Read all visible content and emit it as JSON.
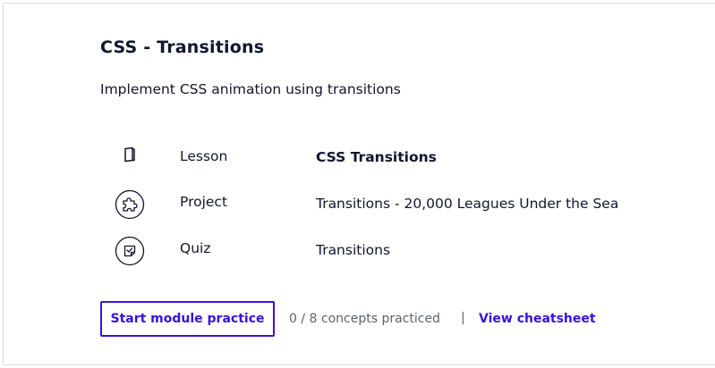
{
  "module": {
    "title": "CSS - Transitions",
    "description": "Implement CSS animation using transitions"
  },
  "items": [
    {
      "icon": "book-icon",
      "type": "Lesson",
      "title": "CSS Transitions"
    },
    {
      "icon": "puzzle-icon",
      "type": "Project",
      "title": "Transitions - 20,000 Leagues Under the Sea"
    },
    {
      "icon": "quiz-icon",
      "type": "Quiz",
      "title": "Transitions"
    }
  ],
  "footer": {
    "start_label": "Start module practice",
    "concepts_text": "0 / 8 concepts practiced",
    "separator": "|",
    "cheatsheet_label": "View cheatsheet"
  },
  "colors": {
    "accent": "#3a10e5",
    "text": "#10162f",
    "muted": "#5c6270",
    "border": "#d6dce4"
  }
}
